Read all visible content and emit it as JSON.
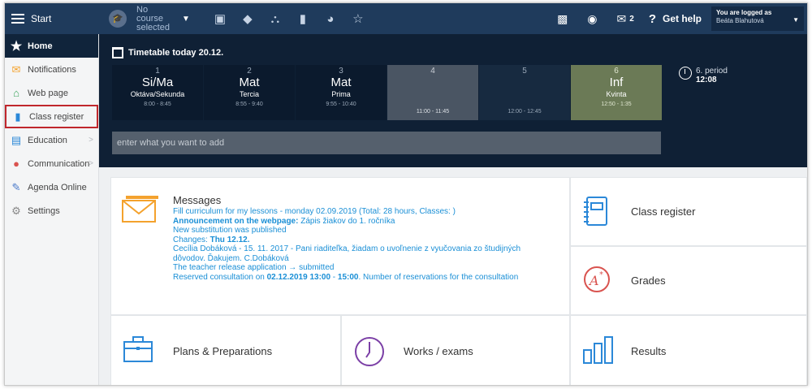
{
  "topbar": {
    "start_label": "Start",
    "course_label": "No course selected",
    "notifications_count": "2",
    "help_label": "Get help",
    "logged_as_label": "You are logged as",
    "user_name": "Beáta Blahutová"
  },
  "sidebar": {
    "items": [
      {
        "label": "Home",
        "icon": "star-icon"
      },
      {
        "label": "Notifications",
        "icon": "envelope-icon"
      },
      {
        "label": "Web page",
        "icon": "house-icon"
      },
      {
        "label": "Class register",
        "icon": "book-icon"
      },
      {
        "label": "Education",
        "icon": "education-icon"
      },
      {
        "label": "Communication",
        "icon": "chat-icon"
      },
      {
        "label": "Agenda Online",
        "icon": "pen-icon"
      },
      {
        "label": "Settings",
        "icon": "gear-icon"
      }
    ]
  },
  "timetable": {
    "title": "Timetable today 20.12.",
    "periods": [
      {
        "num": "1",
        "subject": "Si/Ma",
        "class": "Oktáva/Sekunda",
        "time": "8:00 - 8:45"
      },
      {
        "num": "2",
        "subject": "Mat",
        "class": "Tercia",
        "time": "8:55 - 9:40"
      },
      {
        "num": "3",
        "subject": "Mat",
        "class": "Prima",
        "time": "9:55 - 10:40"
      },
      {
        "num": "4",
        "subject": "",
        "class": "",
        "time": "11:00 - 11:45"
      },
      {
        "num": "5",
        "subject": "",
        "class": "",
        "time": "12:00 - 12:45"
      },
      {
        "num": "6",
        "subject": "Inf",
        "class": "Kvinta",
        "time": "12:50 - 1:35"
      }
    ],
    "current_period": "6. period",
    "current_time": "12:08",
    "add_placeholder": "enter what you want to add"
  },
  "messages": {
    "title": "Messages",
    "line1": "Fill curriculum for my lessons - monday 02.09.2019 (Total: 28 hours, Classes: )",
    "line2_bold": "Announcement on the webpage:",
    "line2_rest": " Zápis žiakov do 1. ročníka",
    "line3": "New substitution was published",
    "line4_label": "Changes: ",
    "line4_bold": "Thu 12.12.",
    "line5": "Cecília Dobáková - 15. 11. 2017 - Pani riaditeľka, žiadam o uvoľnenie z vyučovania zo študijných",
    "line6": "dôvodov. Ďakujem. C.Dobáková",
    "line7": "The teacher release application → submitted",
    "line8_a": "Reserved consultation on ",
    "line8_date": "02.12.2019 13:00",
    "line8_sep": " - ",
    "line8_end": "15:00",
    "line8_rest": ". Number of reservations for the consultation"
  },
  "tiles": {
    "class_register": "Class register",
    "grades": "Grades",
    "plans": "Plans & Preparations",
    "works": "Works / exams",
    "results": "Results"
  },
  "colors": {
    "topbar": "#1f3b5c",
    "timetable_bg": "#0f2035",
    "link_blue": "#1a8fd6",
    "accent_orange": "#f4a22d",
    "selected_border": "#c0272d"
  }
}
